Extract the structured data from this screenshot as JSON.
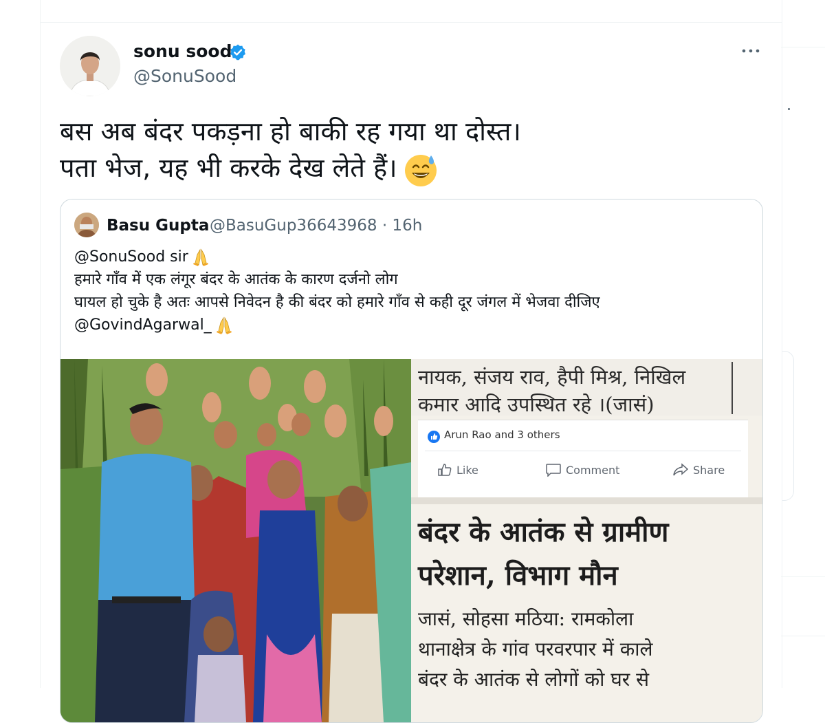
{
  "tweet": {
    "author": {
      "name": "sonu sood",
      "handle": "@SonuSood",
      "verified": true
    },
    "text_lines": [
      "बस अब बंदर पकड़ना हो बाकी रह गया था दोस्त।",
      "पता भेज, यह भी करके देख लेते हैं।"
    ],
    "emoji": "grinning-face-with-sweat",
    "more_icon": "more-horizontal-icon"
  },
  "quote": {
    "author": {
      "name": "Basu Gupta",
      "handle": "@BasuGup36643968",
      "time": "· 16h"
    },
    "lines": [
      "@SonuSood sir",
      "हमारे गाँव में एक लंगूर बंदर के आतंक के कारण दर्जनो लोग",
      "घायल हो चुके है अतः आपसे निवेदन है की बंदर को हमारे गाँव से कही दूर जंगल में भेजवा दीजिए",
      "@GovindAgarwal_"
    ],
    "emoji": "folded-hands"
  },
  "clipping": {
    "top_line1": "नायक, संजय राव, हैपी मिश्र, निखिल",
    "top_line2": "कमार आदि उपस्थित रहे ।(जासं)",
    "fb": {
      "reactions": "Arun Rao and 3 others",
      "like": "Like",
      "comment": "Comment",
      "share": "Share"
    },
    "headline1": "बंदर के आतंक से ग्रामीण",
    "headline2": "परेशान, विभाग मौन",
    "body1": "जासं, सोहसा मठिया: रामकोला",
    "body2": "थानाक्षेत्र के गांव परवरपार में काले",
    "body3": "बंदर के आतंक से लोगों को घर से"
  },
  "colors": {
    "verified": "#1d9bf0",
    "text": "#0f1419",
    "muted": "#536471",
    "border": "#cfd9de",
    "fb_blue": "#1877f2"
  }
}
